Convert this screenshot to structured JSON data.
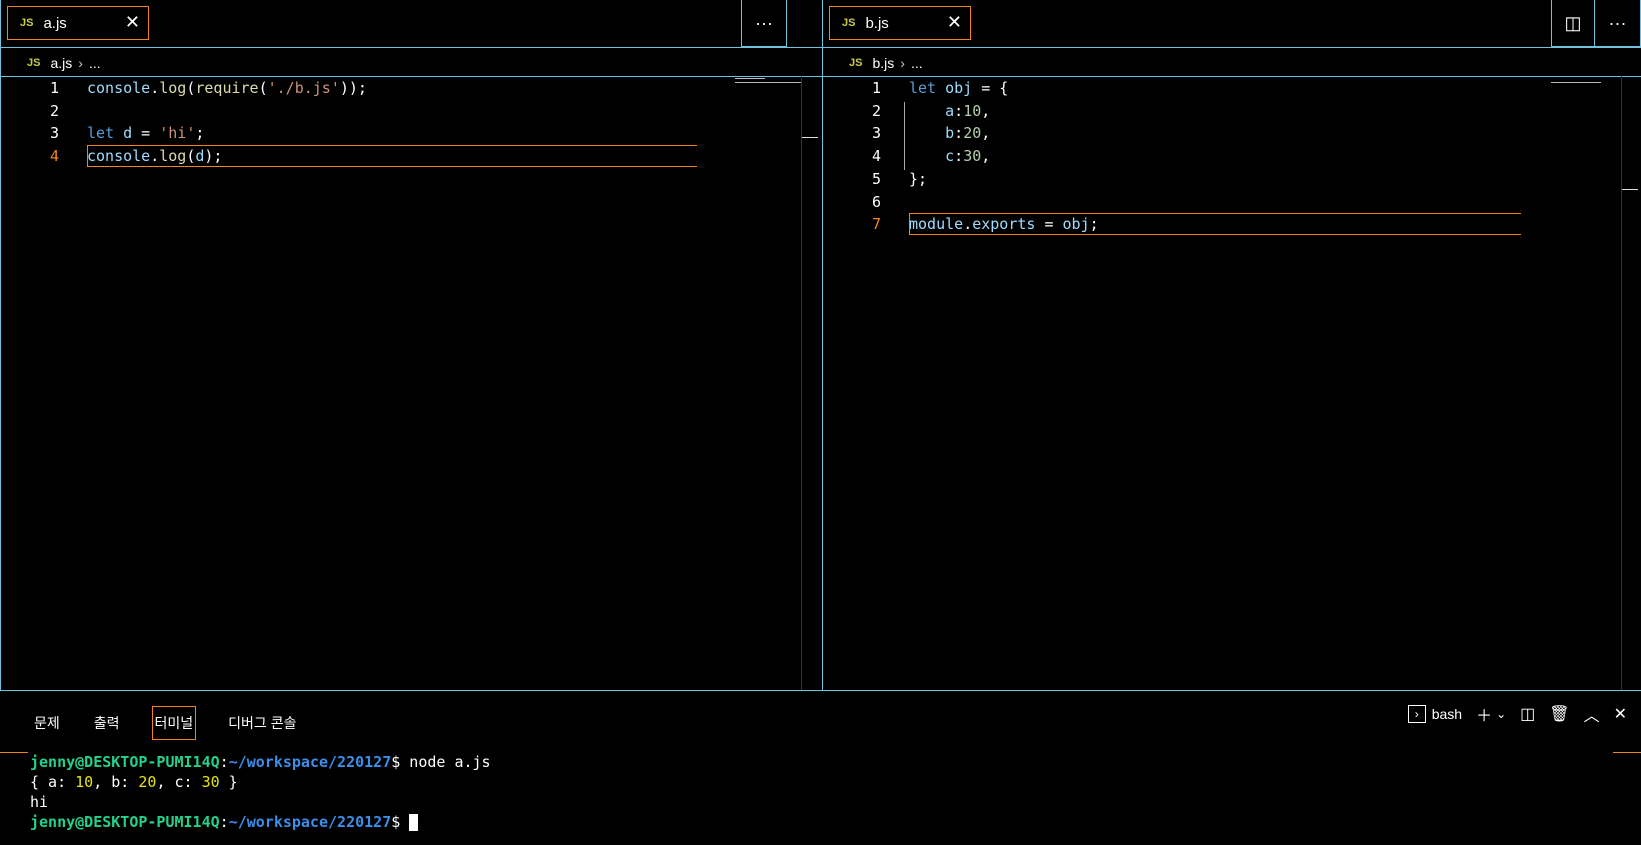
{
  "left": {
    "tab": {
      "icon": "JS",
      "name": "a.js",
      "close": "✕"
    },
    "more": "···",
    "breadcrumb": {
      "icon": "JS",
      "file": "a.js",
      "rest": "..."
    },
    "lines": [
      {
        "n": "1",
        "parts": [
          [
            "var",
            "console"
          ],
          [
            "p",
            "."
          ],
          [
            "fn",
            "log"
          ],
          [
            "p",
            "("
          ],
          [
            "fn",
            "require"
          ],
          [
            "p",
            "("
          ],
          [
            "str",
            "'./b.js'"
          ],
          [
            "p",
            "));"
          ]
        ]
      },
      {
        "n": "2",
        "parts": []
      },
      {
        "n": "3",
        "parts": [
          [
            "kw",
            "let"
          ],
          [
            "p",
            " "
          ],
          [
            "var",
            "d"
          ],
          [
            "p",
            " = "
          ],
          [
            "str",
            "'hi'"
          ],
          [
            "p",
            ";"
          ]
        ]
      },
      {
        "n": "4",
        "parts": [
          [
            "var",
            "console"
          ],
          [
            "p",
            "."
          ],
          [
            "fn",
            "log"
          ],
          [
            "p",
            "("
          ],
          [
            "var",
            "d"
          ],
          [
            "p",
            ");"
          ]
        ]
      }
    ]
  },
  "right": {
    "tab": {
      "icon": "JS",
      "name": "b.js",
      "close": "✕"
    },
    "split": "◫",
    "more": "···",
    "breadcrumb": {
      "icon": "JS",
      "file": "b.js",
      "rest": "..."
    },
    "lines": [
      {
        "n": "1",
        "parts": [
          [
            "kw",
            "let"
          ],
          [
            "p",
            " "
          ],
          [
            "var",
            "obj"
          ],
          [
            "p",
            " = {"
          ]
        ]
      },
      {
        "n": "2",
        "parts": [
          [
            "p",
            "    "
          ],
          [
            "var",
            "a"
          ],
          [
            "p",
            ":"
          ],
          [
            "num",
            "10"
          ],
          [
            "p",
            ","
          ]
        ]
      },
      {
        "n": "3",
        "parts": [
          [
            "p",
            "    "
          ],
          [
            "var",
            "b"
          ],
          [
            "p",
            ":"
          ],
          [
            "num",
            "20"
          ],
          [
            "p",
            ","
          ]
        ]
      },
      {
        "n": "4",
        "parts": [
          [
            "p",
            "    "
          ],
          [
            "var",
            "c"
          ],
          [
            "p",
            ":"
          ],
          [
            "num",
            "30"
          ],
          [
            "p",
            ","
          ]
        ]
      },
      {
        "n": "5",
        "parts": [
          [
            "p",
            "};"
          ]
        ]
      },
      {
        "n": "6",
        "parts": []
      },
      {
        "n": "7",
        "parts": [
          [
            "var",
            "module"
          ],
          [
            "p",
            "."
          ],
          [
            "var",
            "exports"
          ],
          [
            "p",
            " = "
          ],
          [
            "var",
            "obj"
          ],
          [
            "p",
            ";"
          ]
        ]
      }
    ]
  },
  "panel": {
    "tabs": [
      "문제",
      "출력",
      "터미널",
      "디버그 콘솔"
    ],
    "active_tab": "터미널",
    "shell": "bash",
    "terminal": {
      "user": "jenny@DESKTOP-PUMI14Q",
      "path": "~/workspace/220127",
      "command": " node a.js",
      "output1_prefix": "{ a: ",
      "a": "10",
      "sep1": ", b: ",
      "b": "20",
      "sep2": ", c: ",
      "c": "30",
      "output1_suffix": " }",
      "output2": "hi"
    }
  },
  "colors": {
    "accent": "#f38518",
    "border": "#6fc3df"
  }
}
